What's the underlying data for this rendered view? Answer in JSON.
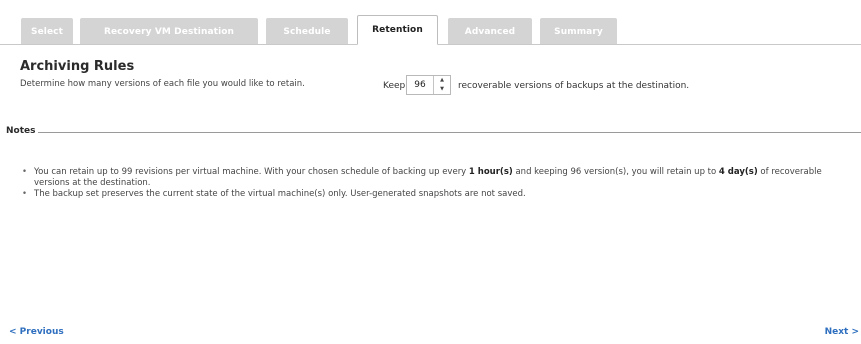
{
  "tabs": [
    {
      "label": "Select",
      "active": false
    },
    {
      "label": "Recovery VM Destination",
      "active": false
    },
    {
      "label": "Schedule",
      "active": false
    },
    {
      "label": "Retention",
      "active": true
    },
    {
      "label": "Advanced",
      "active": false
    },
    {
      "label": "Summary",
      "active": false
    }
  ],
  "archiving": {
    "title": "Archiving Rules",
    "description": "Determine how many versions of each file you would like to retain.",
    "keep_label": "Keep",
    "keep_value": "96",
    "keep_suffix": "recoverable versions of backups at the destination."
  },
  "notes": {
    "title": "Notes",
    "note1": {
      "part1": "You can retain up to 99 revisions per virtual machine. With your chosen schedule of backing up every ",
      "bold1": "1 hour(s)",
      "part2": " and keeping 96 version(s), you will retain up to ",
      "bold2": "4 day(s)",
      "part3": " of recoverable versions at the destination."
    },
    "note2": "The backup set preserves the current state of the virtual machine(s) only. User-generated snapshots are not saved."
  },
  "nav": {
    "previous": "< Previous",
    "next": "Next >"
  },
  "colors": {
    "inactive_tab": "#d4d4d4",
    "link": "#2f6fbf"
  },
  "icons": {
    "spinner_up": "up-arrow-icon",
    "spinner_down": "down-arrow-icon"
  }
}
